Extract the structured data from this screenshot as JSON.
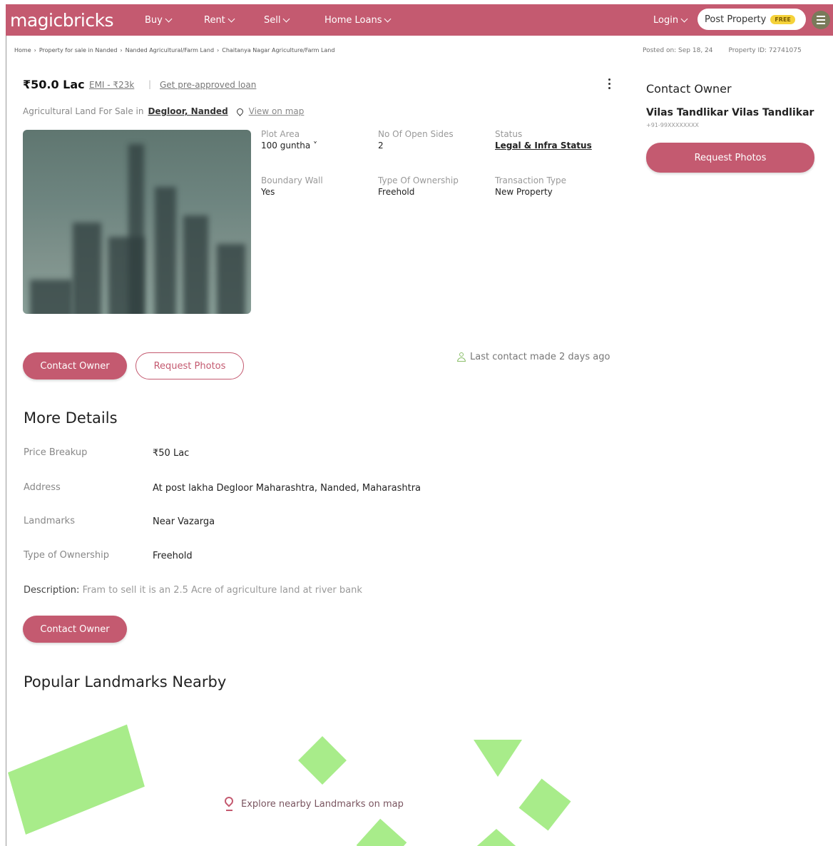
{
  "nav": {
    "logo": "magicbricks",
    "items": [
      {
        "label": "Buy"
      },
      {
        "label": "Rent"
      },
      {
        "label": "Sell"
      },
      {
        "label": "Home Loans"
      }
    ],
    "login": "Login",
    "post_property": "Post Property",
    "free_badge": "FREE"
  },
  "breadcrumb": [
    "Home",
    "›",
    "Property for sale in Nanded",
    "›",
    "Nanded Agricultural/Farm Land",
    "›",
    "Chaitanya Nagar Agriculture/Farm Land"
  ],
  "meta": {
    "posted_on": "Posted on: Sep 18, 24",
    "property_id": "Property ID: 72741075"
  },
  "listing": {
    "price": "₹50.0 Lac",
    "emi": "EMI - ₹23k",
    "separator": "|",
    "loan_link": "Get pre-approved loan",
    "subtitle_prefix": "Agricultural Land For Sale in",
    "location": "Degloor, Nanded",
    "view_on_map": "View on map"
  },
  "specs": [
    {
      "label": "Plot Area",
      "value": "100 guntha ˅"
    },
    {
      "label": "No Of Open Sides",
      "value": "2"
    },
    {
      "label": "Status",
      "value": "Legal & Infra Status"
    },
    {
      "label": "Boundary Wall",
      "value": "Yes"
    },
    {
      "label": "Type Of Ownership",
      "value": "Freehold"
    },
    {
      "label": "Transaction Type",
      "value": "New Property"
    }
  ],
  "actions": {
    "contact_owner": "Contact Owner",
    "request_photos": "Request Photos",
    "last_contact": "Last contact made 2 days ago"
  },
  "contact_card": {
    "title": "Contact Owner",
    "owner_name": "Vilas Tandlikar Vilas Tandlikar",
    "phone": "+91-99XXXXXXXX",
    "request_photos": "Request Photos"
  },
  "more_details": {
    "title": "More Details",
    "rows": [
      {
        "label": "Price Breakup",
        "value": "₹50 Lac"
      },
      {
        "label": "Address",
        "value": "At post lakha Degloor Maharashtra, Nanded, Maharashtra"
      },
      {
        "label": "Landmarks",
        "value": "Near Vazarga"
      },
      {
        "label": "Type of Ownership",
        "value": "Freehold"
      }
    ],
    "description_label": "Description:",
    "description": "Fram to sell it is an 2.5 Acre of agriculture land at river bank",
    "contact_owner": "Contact Owner"
  },
  "landmarks": {
    "title": "Popular Landmarks Nearby",
    "explore": "Explore nearby Landmarks on map"
  },
  "colors": {
    "brand": "#c45a70",
    "map_green": "#a8ec8a"
  }
}
